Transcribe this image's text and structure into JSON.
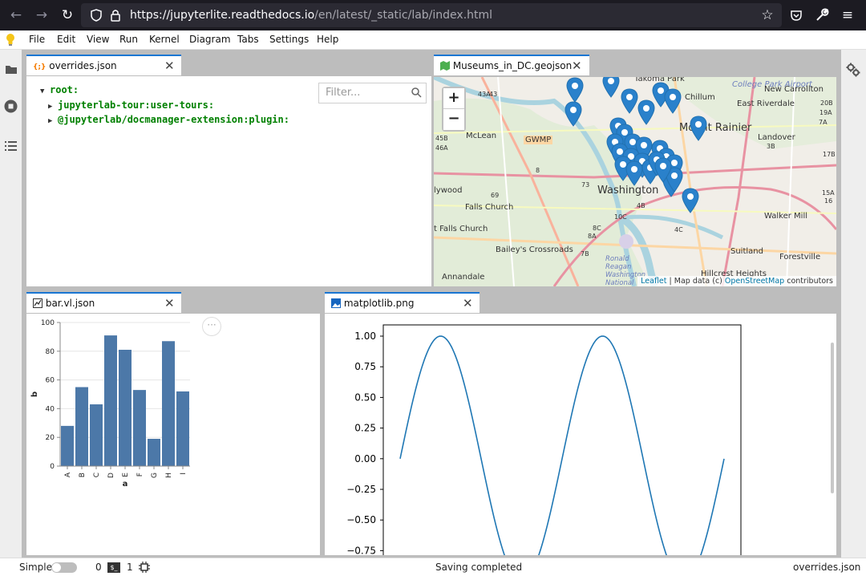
{
  "browser": {
    "url_host": "https://jupyterlite.readthedocs.io",
    "url_path": "/en/latest/_static/lab/index.html"
  },
  "menu": [
    "File",
    "Edit",
    "View",
    "Run",
    "Kernel",
    "Diagram",
    "Tabs",
    "Settings",
    "Help"
  ],
  "panels": {
    "overrides": {
      "tab_label": "overrides.json",
      "filter_placeholder": "Filter...",
      "tree": {
        "root": "root:",
        "items": [
          "jupyterlab-tour:user-tours:",
          "@jupyterlab/docmanager-extension:plugin:"
        ]
      }
    },
    "map": {
      "tab_label": "Museums_in_DC.geojson",
      "zoom_in": "+",
      "zoom_out": "−",
      "attribution_leaflet": "Leaflet",
      "attribution_mid": " | Map data (c) ",
      "attribution_osm": "OpenStreetMap",
      "attribution_end": " contributors",
      "labels": [
        "Takoma Park",
        "Chillum",
        "College Park Airport",
        "New Carrollton",
        "East Riverdale",
        "Mount Rainier",
        "Landover",
        "McLean",
        "GWMP",
        "Washington",
        "Falls Church",
        "Walker Mill",
        "Bailey's Crossroads",
        "Suitland",
        "Forestville",
        "Annandale",
        "Hillcrest Heights",
        "Ronald Reagan Washington National",
        "lywood",
        "t Falls Church",
        "43",
        "43A",
        "45B",
        "46A",
        "69",
        "73",
        "4B",
        "4C",
        "8A",
        "8C",
        "10C",
        "7B",
        "8",
        "17B",
        "19A",
        "7A",
        "3B",
        "15A",
        "16",
        "20B"
      ]
    },
    "bar": {
      "tab_label": "bar.vl.json",
      "more_icon": "···"
    },
    "png": {
      "tab_label": "matplotlib.png"
    }
  },
  "chart_data": [
    {
      "type": "bar",
      "categories": [
        "A",
        "B",
        "C",
        "D",
        "E",
        "F",
        "G",
        "H",
        "I"
      ],
      "values": [
        28,
        55,
        43,
        91,
        81,
        53,
        19,
        87,
        52
      ],
      "xlabel": "a",
      "ylabel": "b",
      "ylim": [
        0,
        100
      ],
      "yticks": [
        0,
        20,
        40,
        60,
        80,
        100
      ],
      "color": "#4c78a8",
      "grid": true
    },
    {
      "type": "line",
      "x_start": 0,
      "x_end": 12.566,
      "function": "sin",
      "yticks": [
        "1.00",
        "0.75",
        "0.50",
        "0.25",
        "0.00",
        "−0.25",
        "−0.50",
        "−0.75"
      ],
      "ylim_visible": [
        -0.85,
        1.09
      ],
      "color": "#1f77b4"
    }
  ],
  "status": {
    "mode_label": "Simple",
    "terminals": "0",
    "kernels": "1",
    "message": "Saving completed",
    "file": "overrides.json"
  },
  "colors": {
    "accent": "#1976d2",
    "tree_key": "#008000",
    "bar": "#4c78a8",
    "line": "#1f77b4",
    "pin": "#2a81cb"
  }
}
